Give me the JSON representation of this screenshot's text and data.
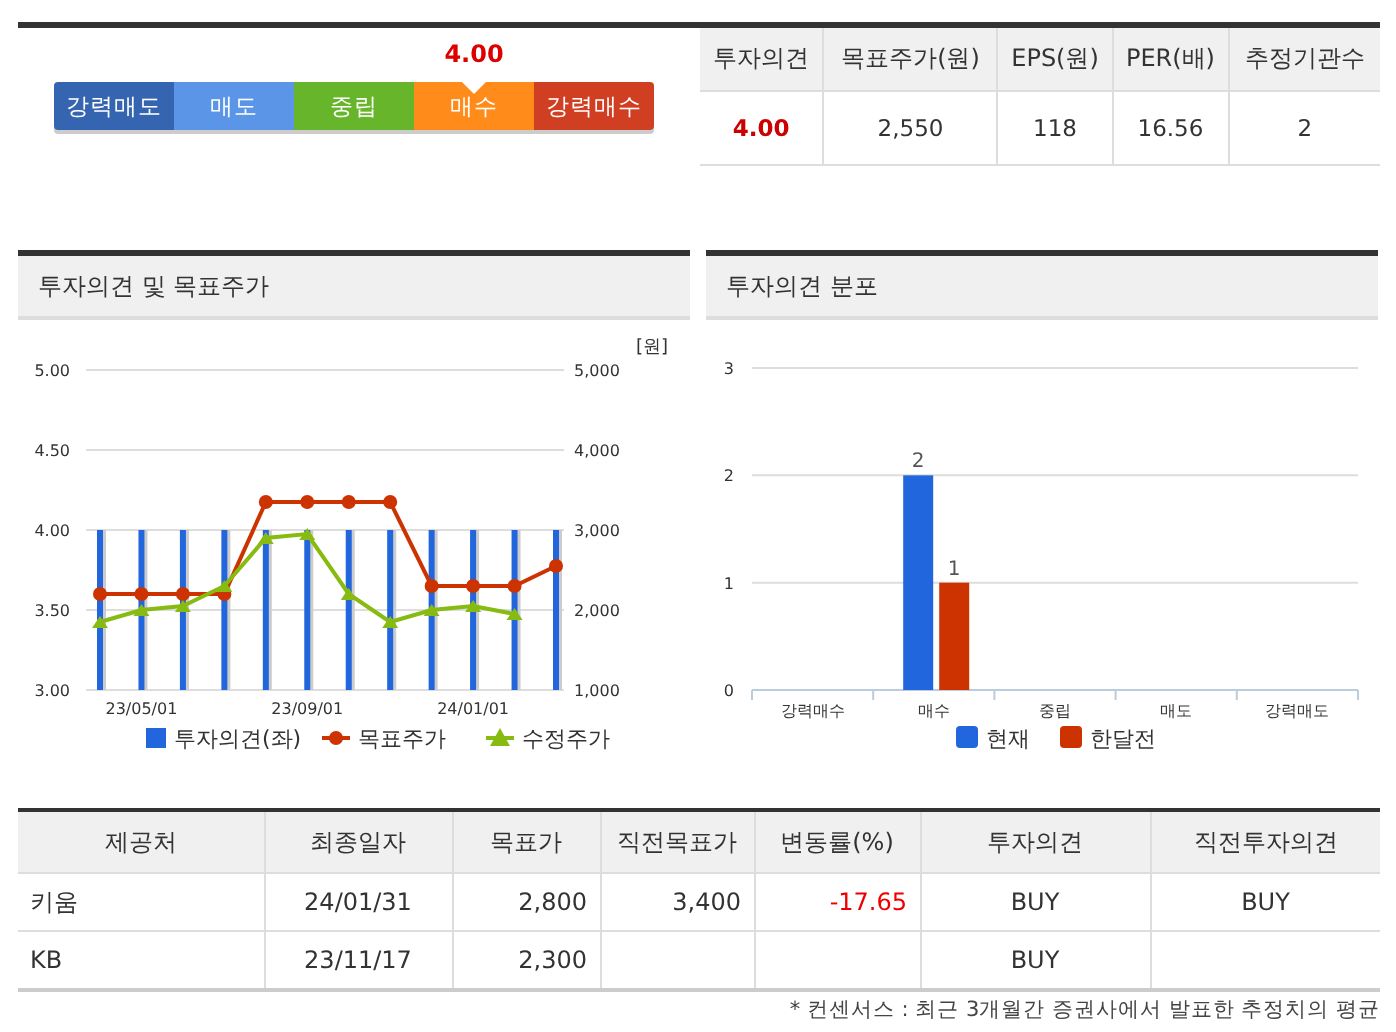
{
  "consensus": {
    "gauge": {
      "value": "4.00",
      "segments": [
        {
          "label": "강력매도",
          "color": "#3565b0",
          "selected": false
        },
        {
          "label": "매도",
          "color": "#5b95e8",
          "selected": false
        },
        {
          "label": "중립",
          "color": "#66b52b",
          "selected": false
        },
        {
          "label": "매수",
          "color": "#ff8c1a",
          "selected": true
        },
        {
          "label": "강력매수",
          "color": "#d13f22",
          "selected": false
        }
      ]
    },
    "summary_table": {
      "columns": [
        "투자의견",
        "목표주가(원)",
        "EPS(원)",
        "PER(배)",
        "추정기관수"
      ],
      "row": [
        "4.00",
        "2,550",
        "118",
        "16.56",
        "2"
      ]
    }
  },
  "charts": [
    {
      "title": "투자의견 및 목표주가",
      "unit": "[원]",
      "chart_data": {
        "type": "line",
        "legend": "bottom",
        "grid": true,
        "categories": [
          null,
          "23/05/01",
          null,
          null,
          null,
          "23/09/01",
          null,
          null,
          null,
          "24/01/01",
          null,
          null
        ],
        "ylim": [
          3,
          5
        ],
        "yticks": [
          {
            "value": 3,
            "label": "3.00"
          },
          {
            "value": 3.5,
            "label": "3.50"
          },
          {
            "value": 4,
            "label": "4.00"
          },
          {
            "value": 4.5,
            "label": "4.50"
          },
          {
            "value": 5,
            "label": "5.00"
          }
        ],
        "y2lim": [
          1000,
          5000
        ],
        "y2ticks": [
          {
            "value": 1000,
            "label": "1,000"
          },
          {
            "value": 2000,
            "label": "2,000"
          },
          {
            "value": 3000,
            "label": "3,000"
          },
          {
            "value": 4000,
            "label": "4,000"
          },
          {
            "value": 5000,
            "label": "5,000"
          }
        ],
        "series": [
          {
            "name": "투자의견(좌)",
            "type": "bar",
            "color": "#2266dd",
            "values": [
              4,
              4,
              4,
              4,
              4,
              4,
              4,
              4,
              4,
              4,
              4,
              4
            ]
          },
          {
            "name": "목표주가",
            "type": "line",
            "axis": "y2",
            "marker": "circle",
            "color": "#cc3300",
            "values": [
              2200,
              2200,
              2200,
              2200,
              3350,
              3350,
              3350,
              3350,
              2300,
              2300,
              2300,
              2550
            ]
          },
          {
            "name": "수정주가",
            "type": "line",
            "axis": "y2",
            "marker": "triangle",
            "color": "#88bb11",
            "values": [
              1850,
              2000,
              2050,
              2300,
              2900,
              2950,
              2200,
              1850,
              2000,
              2050,
              1950,
              null
            ]
          }
        ]
      }
    },
    {
      "title": "투자의견 분포",
      "chart_data": {
        "type": "bar",
        "legend": "bottom",
        "grid": true,
        "categories": [
          "강력매수",
          "매수",
          "중립",
          "매도",
          "강력매도"
        ],
        "ylim": [
          0,
          3
        ],
        "yticks": [
          0,
          1,
          2,
          3
        ],
        "value_labels": [
          [
            null,
            "2",
            null,
            null,
            null
          ],
          [
            null,
            "1",
            null,
            null,
            null
          ]
        ],
        "series": [
          {
            "name": "현재",
            "color": "#2266dd",
            "values": [
              0,
              2,
              0,
              0,
              0
            ]
          },
          {
            "name": "한달전",
            "color": "#cc3300",
            "values": [
              0,
              1,
              0,
              0,
              0
            ]
          }
        ]
      }
    }
  ],
  "broker_table": {
    "columns": [
      "제공처",
      "최종일자",
      "목표가",
      "직전목표가",
      "변동률(%)",
      "투자의견",
      "직전투자의견"
    ],
    "rows": [
      {
        "provider": "키움",
        "date": "24/01/31",
        "target": "2,800",
        "prev_target": "3,400",
        "change": "-17.65",
        "opinion": "BUY",
        "prev_opinion": "BUY"
      },
      {
        "provider": "KB",
        "date": "23/11/17",
        "target": "2,300",
        "opinion": "BUY"
      }
    ]
  },
  "footnote": "* 컨센서스 : 최근 3개월간 증권사에서 발표한 추정치의 평균"
}
